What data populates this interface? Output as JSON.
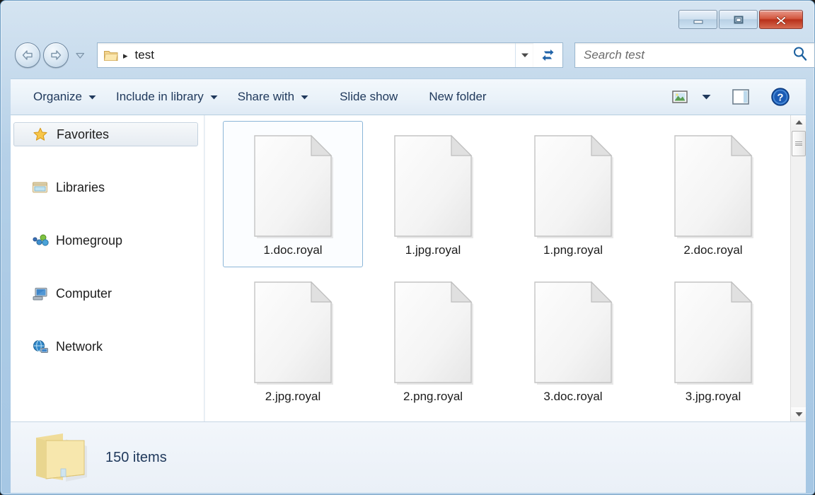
{
  "window": {
    "title": "",
    "buttons": {
      "minimize": {
        "name": "minimize-button",
        "label": "Minimize"
      },
      "maximize": {
        "name": "maximize-button",
        "label": "Maximize"
      },
      "close": {
        "name": "close-button",
        "label": "Close"
      }
    }
  },
  "navbar": {
    "back_title": "Back",
    "forward_title": "Forward",
    "history_title": "Recent pages",
    "refresh_title": "Refresh",
    "address": {
      "folder_icon": "folder-icon",
      "separator": "▸",
      "crumb": "test"
    },
    "search": {
      "placeholder": "Search test",
      "value": "",
      "icon": "search-icon"
    }
  },
  "toolbar": {
    "items": [
      {
        "label": "Organize",
        "caret": true,
        "name": "toolbar-organize"
      },
      {
        "label": "Include in library",
        "caret": true,
        "name": "toolbar-include-in-library"
      },
      {
        "label": "Share with",
        "caret": true,
        "name": "toolbar-share-with"
      },
      {
        "label": "Slide show",
        "caret": false,
        "name": "toolbar-slide-show"
      },
      {
        "label": "New folder",
        "caret": false,
        "name": "toolbar-new-folder"
      }
    ],
    "view_button": {
      "name": "change-view-icon",
      "label": "Change your view"
    },
    "view_dropdown": {
      "name": "view-dropdown-caret",
      "label": "More options"
    },
    "preview_button": {
      "name": "preview-pane-icon",
      "label": "Show the preview pane"
    },
    "help_button": {
      "name": "help-icon",
      "label": "Get help"
    }
  },
  "sidebar": {
    "items": [
      {
        "label": "Favorites",
        "icon": "star-icon",
        "selected": true
      },
      {
        "label": "Libraries",
        "icon": "libraries-folder-icon",
        "selected": false
      },
      {
        "label": "Homegroup",
        "icon": "homegroup-icon",
        "selected": false
      },
      {
        "label": "Computer",
        "icon": "computer-icon",
        "selected": false
      },
      {
        "label": "Network",
        "icon": "network-globe-icon",
        "selected": false
      }
    ]
  },
  "files": {
    "items": [
      {
        "name": "1.doc.royal",
        "icon": "generic-file-icon",
        "selected": true
      },
      {
        "name": "1.jpg.royal",
        "icon": "generic-file-icon",
        "selected": false
      },
      {
        "name": "1.png.royal",
        "icon": "generic-file-icon",
        "selected": false
      },
      {
        "name": "2.doc.royal",
        "icon": "generic-file-icon",
        "selected": false
      },
      {
        "name": "2.jpg.royal",
        "icon": "generic-file-icon",
        "selected": false
      },
      {
        "name": "2.png.royal",
        "icon": "generic-file-icon",
        "selected": false
      },
      {
        "name": "3.doc.royal",
        "icon": "generic-file-icon",
        "selected": false
      },
      {
        "name": "3.jpg.royal",
        "icon": "generic-file-icon",
        "selected": false
      }
    ]
  },
  "status": {
    "icon": "folder-icon",
    "text": "150 items"
  },
  "colors": {
    "frame_blue": "#aeccE6",
    "close_red": "#c03a22",
    "selection_border": "#8ab5d8",
    "toolbar_text": "#20395c",
    "folder_yellow": "#f2d488"
  }
}
